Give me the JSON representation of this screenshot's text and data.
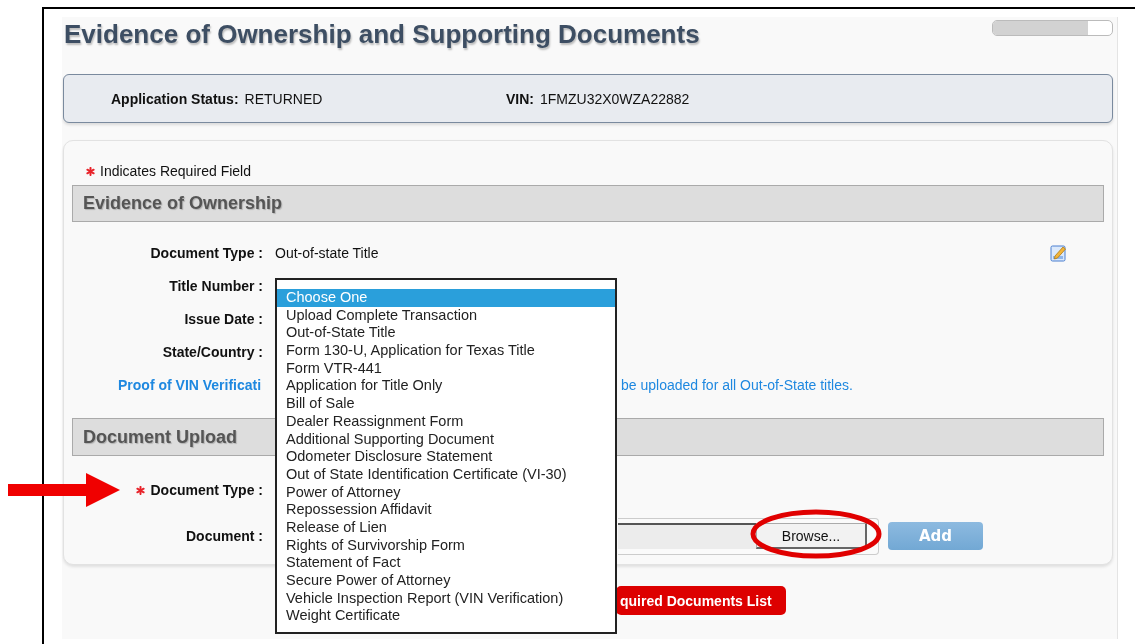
{
  "page": {
    "title": "Evidence of Ownership and Supporting Documents",
    "progress": {
      "level": 0.8
    }
  },
  "status": {
    "fields": [
      {
        "label": "Application Status:",
        "value": "RETURNED"
      },
      {
        "label": "VIN:",
        "value": "1FMZU32X0WZA22882"
      }
    ]
  },
  "required_note": "Indicates Required Field",
  "evidence_of_ownership": {
    "heading": "Evidence of Ownership",
    "fields": [
      {
        "label": "Document Type :",
        "value": "Out-of-state Title"
      },
      {
        "label": "Title Number :"
      },
      {
        "label": "Issue Date :"
      },
      {
        "label": "State/Country :"
      }
    ],
    "proof_link": "Proof of VIN Verificati",
    "proof_note": "be uploaded for all Out-of-State titles."
  },
  "document_upload": {
    "heading": "Document Upload",
    "fields": [
      {
        "label": "Document Type :",
        "required": true,
        "kind": "select"
      },
      {
        "label": "Document :",
        "required": false,
        "kind": "file",
        "button": "Browse..."
      }
    ],
    "add_button": "Add"
  },
  "required_documents_button": "quired Documents List",
  "dropdown": {
    "options": [
      {
        "label": "Choose One",
        "selected": true
      },
      {
        "label": "Upload Complete Transaction",
        "selected": false
      },
      {
        "label": "Out-of-State Title",
        "selected": false
      },
      {
        "label": "Form 130-U, Application for Texas Title",
        "selected": false
      },
      {
        "label": "Form VTR-441",
        "selected": false
      },
      {
        "label": "Application for Title Only",
        "selected": false
      },
      {
        "label": "Bill of Sale",
        "selected": false
      },
      {
        "label": "Dealer Reassignment Form",
        "selected": false
      },
      {
        "label": "Additional Supporting Document",
        "selected": false
      },
      {
        "label": "Odometer Disclosure Statement",
        "selected": false
      },
      {
        "label": "Out of State Identification Certificate (VI-30)",
        "selected": false
      },
      {
        "label": "Power of Attorney",
        "selected": false
      },
      {
        "label": "Repossession Affidavit",
        "selected": false
      },
      {
        "label": "Release of Lien",
        "selected": false
      },
      {
        "label": "Rights of Survivorship Form",
        "selected": false
      },
      {
        "label": "Statement of Fact",
        "selected": false
      },
      {
        "label": "Secure Power of Attorney",
        "selected": false
      },
      {
        "label": "Vehicle Inspection Report (VIN Verification)",
        "selected": false
      },
      {
        "label": "Weight Certificate",
        "selected": false
      }
    ]
  }
}
